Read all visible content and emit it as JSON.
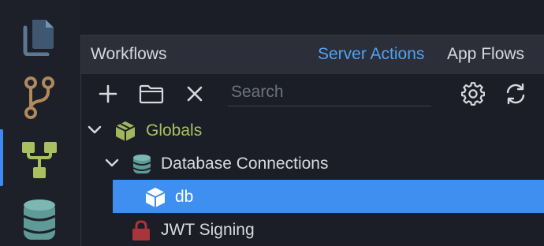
{
  "activity_bar": {
    "items": [
      {
        "name": "files",
        "icon": "document-stack-icon"
      },
      {
        "name": "source-control",
        "icon": "git-branch-icon"
      },
      {
        "name": "workflows",
        "icon": "workflow-tree-icon",
        "active": true
      },
      {
        "name": "database",
        "icon": "database-icon"
      }
    ],
    "accent": "#3d8bf2"
  },
  "panel": {
    "title": "Workflows",
    "tabs": [
      {
        "label": "Server Actions",
        "active": true
      },
      {
        "label": "App Flows",
        "active": false
      }
    ]
  },
  "toolbar": {
    "add_icon": "plus-icon",
    "folder_icon": "folder-icon",
    "delete_icon": "close-icon",
    "search": {
      "placeholder": "Search",
      "value": ""
    },
    "settings_icon": "gear-icon",
    "refresh_icon": "refresh-icon"
  },
  "tree": {
    "nodes": [
      {
        "label": "Globals",
        "icon": "package-icon",
        "expanded": true,
        "level": 0
      },
      {
        "label": "Database Connections",
        "icon": "database-icon",
        "expanded": true,
        "level": 1
      },
      {
        "label": "db",
        "icon": "cube-icon",
        "selected": true,
        "level": 2
      },
      {
        "label": "JWT Signing",
        "icon": "lock-icon",
        "level": 1
      }
    ]
  },
  "colors": {
    "selection": "#3f8ff0",
    "link": "#4fa3f2",
    "globals": "#a8c060",
    "lock": "#a8353a"
  }
}
